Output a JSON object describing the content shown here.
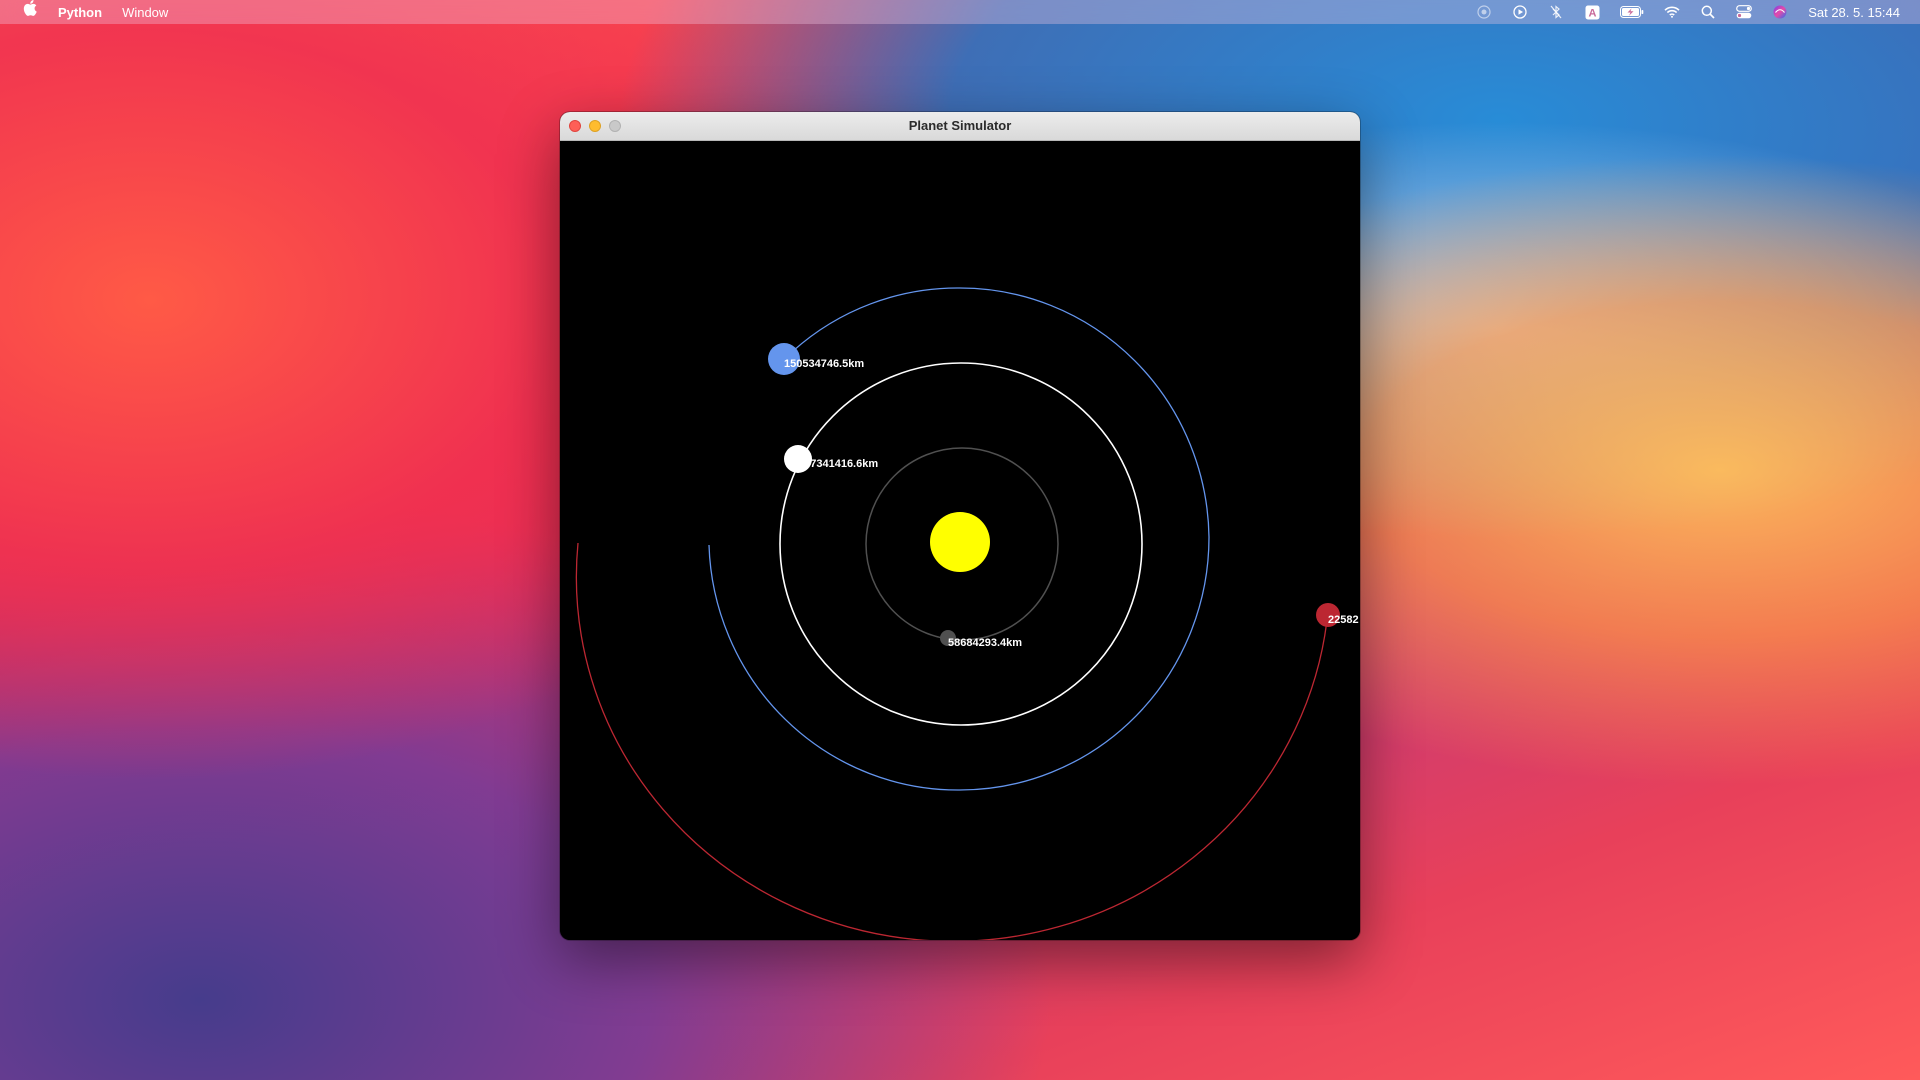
{
  "menubar": {
    "apple_icon": "apple-logo-icon",
    "app_name": "Python",
    "menus": [
      "Window"
    ],
    "status_icons": [
      "screen-record-icon",
      "play-circle-icon",
      "bluetooth-off-icon",
      "keyboard-input-A-icon",
      "battery-charging-icon",
      "wifi-icon",
      "spotlight-search-icon",
      "control-center-icon",
      "siri-icon"
    ],
    "keyboard_input_label": "A",
    "clock": "Sat 28. 5.  15:44"
  },
  "window": {
    "title": "Planet Simulator"
  },
  "simulation": {
    "colors": {
      "background": "#000000",
      "sun": "#ffff00",
      "mercury": "#505050",
      "venus": "#ffffff",
      "earth": "#6495ed",
      "mars": "#bc2732"
    },
    "planets": [
      {
        "name": "mercury",
        "distance_label": "58684293.4km"
      },
      {
        "name": "venus",
        "distance_label": "107341416.6km"
      },
      {
        "name": "earth",
        "distance_label": "150534746.5km"
      },
      {
        "name": "mars",
        "distance_label": "22582"
      }
    ]
  }
}
